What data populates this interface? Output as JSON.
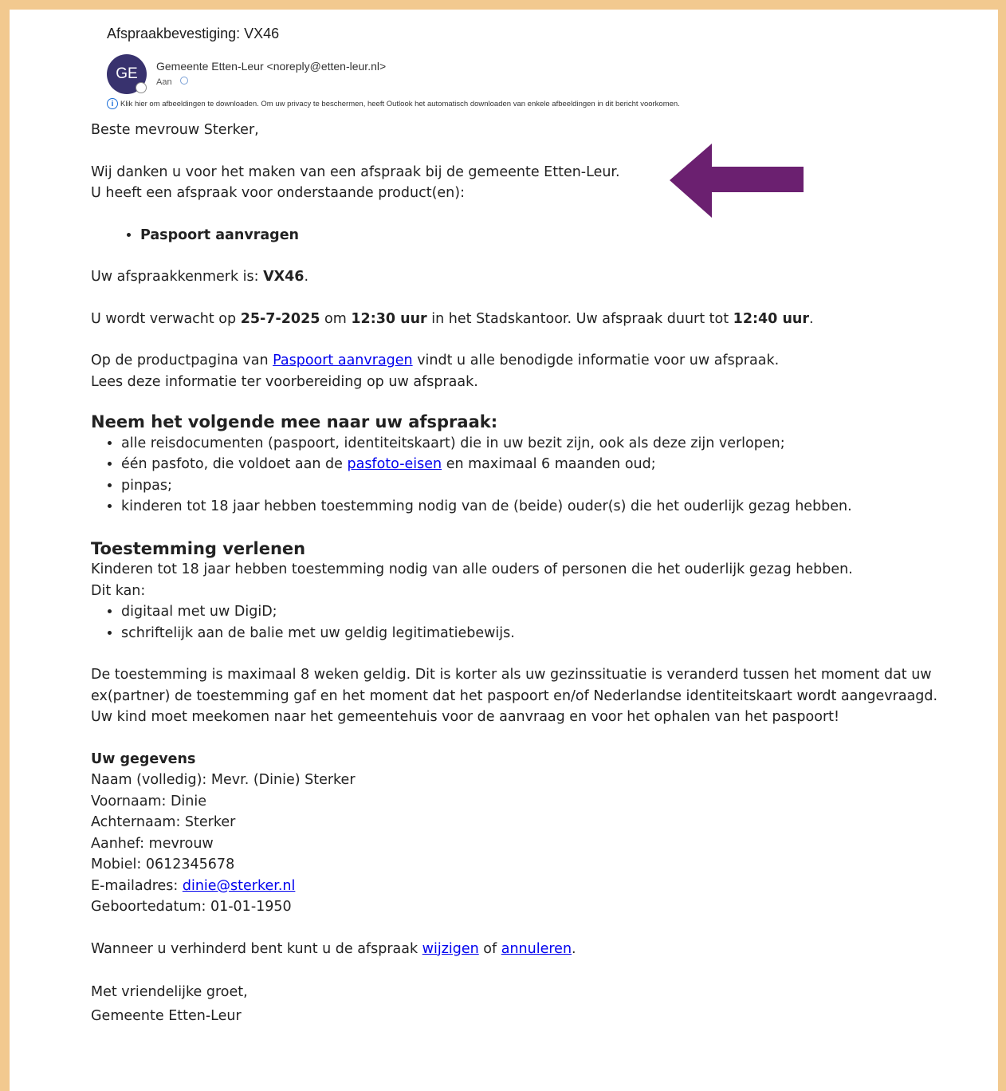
{
  "email": {
    "subject": "Afspraakbevestiging: VX46",
    "avatar_initials": "GE",
    "sender": "Gemeente Etten-Leur <noreply@etten-leur.nl>",
    "to_label": "Aan",
    "image_notice": "Klik hier om afbeeldingen te downloaden. Om uw privacy te beschermen, heeft Outlook het automatisch downloaden van enkele afbeeldingen in dit bericht voorkomen."
  },
  "body": {
    "greeting": "Beste mevrouw Sterker,",
    "thanks_line": "Wij danken u voor het maken van een afspraak bij de gemeente Etten-Leur.",
    "products_intro": "U heeft een afspraak voor onderstaande product(en):",
    "products": [
      "Paspoort aanvragen"
    ],
    "reference_prefix": "Uw afspraakkenmerk is: ",
    "reference": "VX46",
    "reference_suffix": ".",
    "expected_prefix": "U wordt verwacht op ",
    "date": "25-7-2025",
    "expected_om": " om ",
    "time_start": "12:30 uur",
    "expected_mid": " in het Stadskantoor. Uw afspraak duurt tot ",
    "time_end": "12:40 uur",
    "expected_suffix": ".",
    "product_page_prefix": "Op de productpagina van ",
    "product_page_link": "Paspoort aanvragen",
    "product_page_suffix": " vindt u alle benodigde informatie voor uw afspraak.",
    "prepare_line": "Lees deze informatie ter voorbereiding op uw afspraak.",
    "bring_heading": "Neem het volgende mee naar uw afspraak:",
    "bring_item_1": "alle reisdocumenten (paspoort, identiteitskaart) die in uw bezit zijn, ook als deze zijn verlopen;",
    "bring_item_2_prefix": "één pasfoto, die voldoet aan de ",
    "bring_item_2_link": "pasfoto-eisen",
    "bring_item_2_suffix": " en maximaal 6 maanden oud;",
    "bring_item_3": "pinpas;",
    "bring_item_4": "kinderen tot 18 jaar hebben toestemming nodig van de (beide) ouder(s) die het ouderlijk gezag hebben.",
    "consent_heading": "Toestemming verlenen",
    "consent_text_1": "Kinderen tot 18 jaar hebben toestemming nodig van alle ouders of personen die het ouderlijk gezag hebben.",
    "consent_text_2": "Dit kan:",
    "consent_item_1": "digitaal met uw DigiD;",
    "consent_item_2": "schriftelijk aan de balie met uw geldig legitimatiebewijs.",
    "validity_text": "De toestemming is maximaal 8 weken geldig. Dit is korter als uw gezinssituatie is veranderd tussen het moment dat uw ex(partner) de toestemming gaf en het moment dat het paspoort en/of Nederlandse identiteitskaart wordt aangevraagd.",
    "child_text": "Uw kind moet meekomen naar het gemeentehuis voor de aanvraag en voor het ophalen van het paspoort!",
    "details_heading": "Uw gegevens",
    "details_full_name": "Naam (volledig): Mevr. (Dinie) Sterker",
    "details_first_name": "Voornaam: Dinie",
    "details_last_name": "Achternaam: Sterker",
    "details_salutation": "Aanhef: mevrouw",
    "details_mobile": "Mobiel: 0612345678",
    "details_email_prefix": "E-mailadres: ",
    "details_email": "dinie@sterker.nl",
    "details_birthdate": "Geboortedatum: 01-01-1950",
    "change_prefix": "Wanneer u verhinderd bent kunt u de afspraak ",
    "change_link": "wijzigen",
    "change_or": " of ",
    "cancel_link": "annuleren",
    "change_suffix": ".",
    "closing": "Met vriendelijke groet,",
    "signature": "Gemeente Etten-Leur"
  },
  "colors": {
    "frame_border": "#f2c98f",
    "avatar_bg": "#38326e",
    "arrow": "#6b2070",
    "link": "#0000ee"
  },
  "icons": {
    "info": "info-circle-icon",
    "annotation": "arrow-left-icon"
  }
}
